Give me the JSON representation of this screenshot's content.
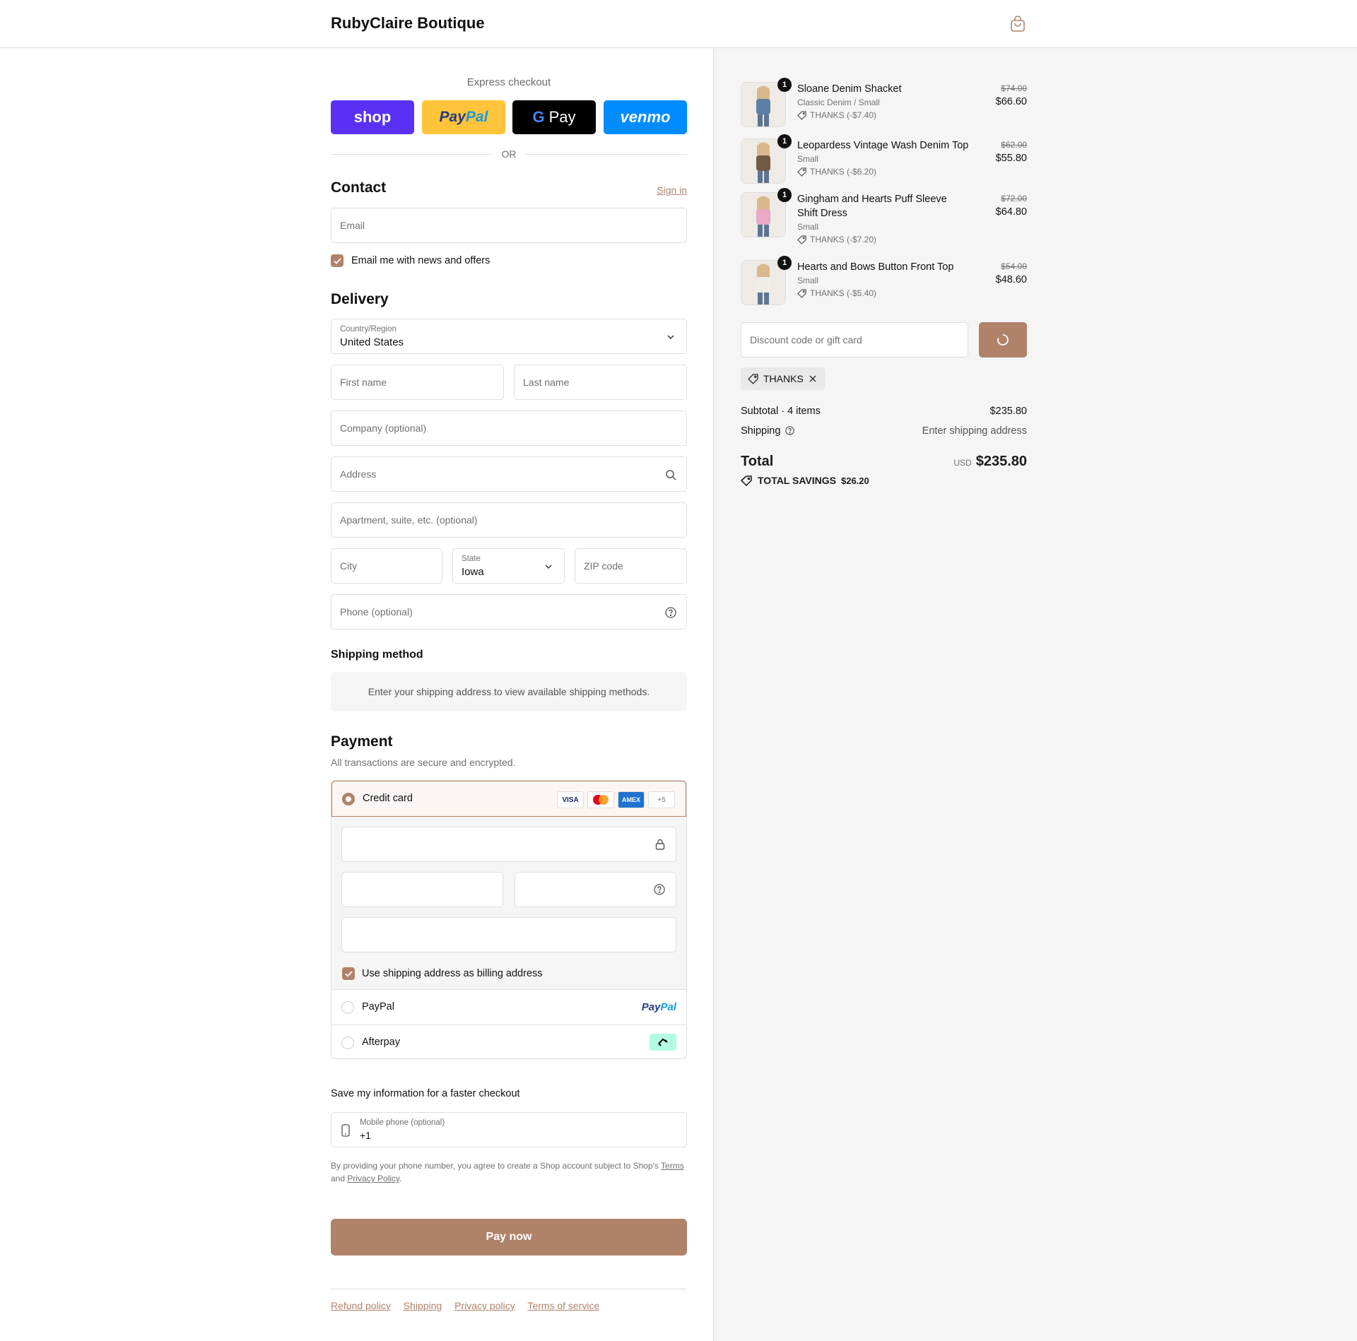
{
  "header": {
    "brand": "RubyClaire Boutique"
  },
  "express": {
    "title": "Express checkout",
    "shop": "shop",
    "paypal_a": "Pay",
    "paypal_b": "Pal",
    "gpay_g": "G",
    "gpay": "Pay",
    "venmo": "venmo",
    "or": "OR"
  },
  "contact": {
    "title": "Contact",
    "sign_in": "Sign in",
    "email_placeholder": "Email",
    "news_label": "Email me with news and offers",
    "news_checked": true
  },
  "delivery": {
    "title": "Delivery",
    "country_label": "Country/Region",
    "country_value": "United States",
    "first_name": "First name",
    "last_name": "Last name",
    "company": "Company (optional)",
    "address": "Address",
    "apartment": "Apartment, suite, etc. (optional)",
    "city": "City",
    "state_label": "State",
    "state_value": "Iowa",
    "zip": "ZIP code",
    "phone": "Phone (optional)"
  },
  "shipping_method": {
    "title": "Shipping method",
    "info": "Enter your shipping address to view available shipping methods."
  },
  "payment": {
    "title": "Payment",
    "subtitle": "All transactions are secure and encrypted.",
    "credit_card": "Credit card",
    "card_badges": [
      "VISA",
      "MC",
      "AMEX",
      "+5"
    ],
    "billing_label": "Use shipping address as billing address",
    "paypal": "PayPal",
    "paypal_logo_a": "Pay",
    "paypal_logo_b": "Pal",
    "afterpay": "Afterpay"
  },
  "save_info": {
    "title": "Save my information for a faster checkout",
    "mobile_label": "Mobile phone (optional)",
    "mobile_value": "+1",
    "fine_print_a": "By providing your phone number, you agree to create a Shop account subject to Shop's",
    "terms": "Terms",
    "fine_print_b": "and",
    "privacy": "Privacy Policy",
    "fine_print_c": "."
  },
  "pay_now": "Pay now",
  "footer": [
    "Refund policy",
    "Shipping",
    "Privacy policy",
    "Terms of service"
  ],
  "order": {
    "items": [
      {
        "qty": "1",
        "name": "Sloane Denim Shacket",
        "variant": "Classic Denim / Small",
        "discount": "THANKS (-$7.40)",
        "old_price": "$74.00",
        "price": "$66.60",
        "color": "#5d7fa3"
      },
      {
        "qty": "1",
        "name": "Leopardess Vintage Wash Denim Top",
        "variant": "Small",
        "discount": "THANKS (-$6.20)",
        "old_price": "$62.00",
        "price": "$55.80",
        "color": "#6f5a45"
      },
      {
        "qty": "1",
        "name": "Gingham and Hearts Puff Sleeve Shift Dress",
        "variant": "Small",
        "discount": "THANKS (-$7.20)",
        "old_price": "$72.00",
        "price": "$64.80",
        "color": "#e9a8c4"
      },
      {
        "qty": "1",
        "name": "Hearts and Bows Button Front Top",
        "variant": "Small",
        "discount": "THANKS (-$5.40)",
        "old_price": "$54.00",
        "price": "$48.60",
        "color": "#f0ece6"
      }
    ],
    "discount_placeholder": "Discount code or gift card",
    "applied_code": "THANKS",
    "subtotal_label": "Subtotal · 4 items",
    "subtotal_value": "$235.80",
    "shipping_label": "Shipping",
    "shipping_value": "Enter shipping address",
    "total_label": "Total",
    "currency": "USD",
    "total_value": "$235.80",
    "savings_label": "TOTAL SAVINGS",
    "savings_value": "$26.20"
  },
  "colors": {
    "accent": "#b0826a",
    "panel": "#f5f5f5",
    "shop": "#5a31f4",
    "paypal": "#ffc439",
    "venmo": "#008cff"
  }
}
